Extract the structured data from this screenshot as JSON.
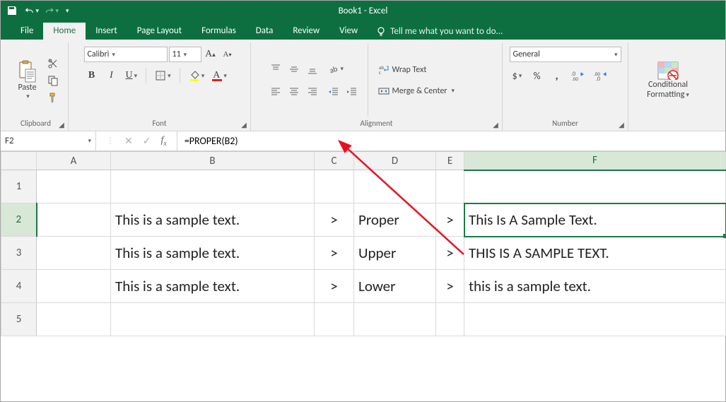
{
  "app": {
    "title": "Book1 - Excel"
  },
  "tabs": {
    "file": "File",
    "home": "Home",
    "insert": "Insert",
    "page_layout": "Page Layout",
    "formulas": "Formulas",
    "data": "Data",
    "review": "Review",
    "view": "View",
    "tell_me": "Tell me what you want to do..."
  },
  "ribbon": {
    "clipboard": {
      "label": "Clipboard",
      "paste": "Paste"
    },
    "font": {
      "label": "Font",
      "name": "Calibri",
      "size": "11"
    },
    "alignment": {
      "label": "Alignment",
      "wrap": "Wrap Text",
      "merge": "Merge & Center"
    },
    "number": {
      "label": "Number",
      "format": "General"
    },
    "conditional": {
      "line1": "Conditional",
      "line2": "Formatting"
    }
  },
  "namebox": {
    "value": "F2"
  },
  "formula": {
    "value": "=PROPER(B2)"
  },
  "columns": {
    "A": "A",
    "B": "B",
    "C": "C",
    "D": "D",
    "E": "E",
    "F": "F"
  },
  "rows": {
    "r1": "1",
    "r2": "2",
    "r3": "3",
    "r4": "4",
    "r5": "5"
  },
  "cells": {
    "B2": "This is a sample text.",
    "C2": ">",
    "D2": "Proper",
    "E2": ">",
    "F2": "This Is A Sample Text.",
    "B3": "This is a sample text.",
    "C3": ">",
    "D3": "Upper",
    "E3": ">",
    "F3": "THIS IS A SAMPLE TEXT.",
    "B4": "This is a sample text.",
    "C4": ">",
    "D4": "Lower",
    "E4": ">",
    "F4": "this is a sample text."
  },
  "colors": {
    "excel_green": "#217346",
    "titlebar_green": "#0d6f3f",
    "arrow_red": "#e81123"
  }
}
